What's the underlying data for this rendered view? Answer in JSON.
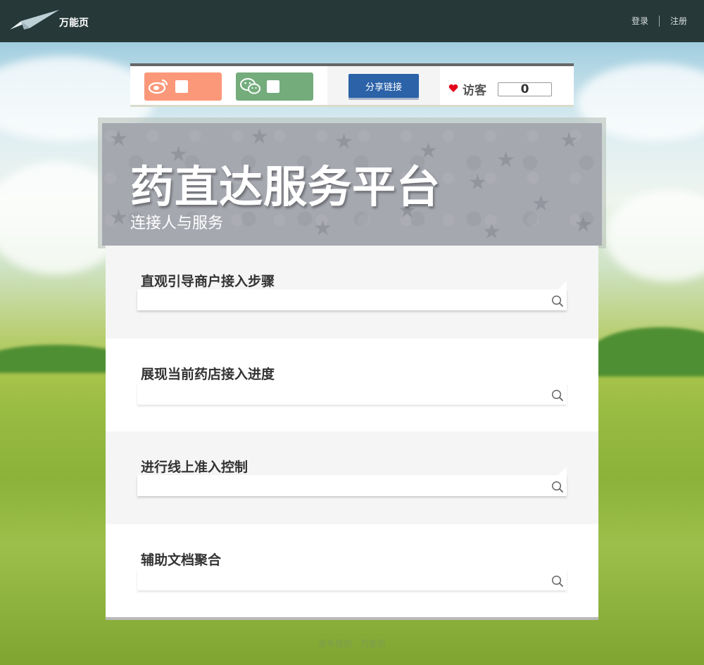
{
  "header": {
    "logo_text": "万能页",
    "login_label": "登录",
    "register_label": "注册"
  },
  "share_bar": {
    "weibo_icon": "weibo-icon",
    "wechat_icon": "wechat-icon",
    "share_button_label": "分享链接",
    "visitor_label": "访客",
    "visitor_count": "0"
  },
  "banner": {
    "title": "药直达服务平台",
    "subtitle": "连接人与服务"
  },
  "sections": [
    {
      "heading": "直观引导商户接入步骤"
    },
    {
      "heading": "展现当前药店接入进度"
    },
    {
      "heading": "进行线上准入控制"
    },
    {
      "heading": "辅助文档聚合"
    }
  ],
  "footer": {
    "text": "发布我的 · 万能页"
  },
  "colors": {
    "topbar": "#263838",
    "weibo": "#fb987a",
    "wechat": "#74ac7c",
    "share_button": "#2b62a8",
    "heart": "#e3001b"
  }
}
